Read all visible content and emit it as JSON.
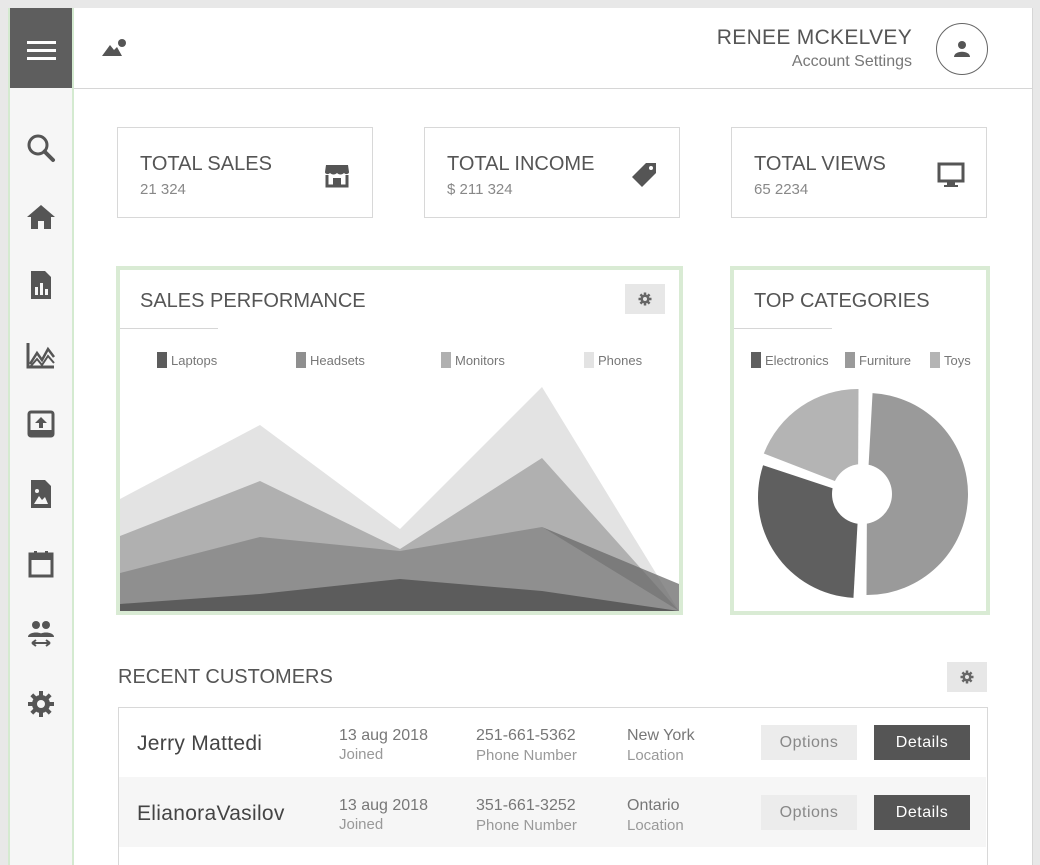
{
  "header": {
    "user_name": "RENEE MCKELVEY",
    "account_link": "Account Settings"
  },
  "sidebar": {
    "items": [
      {
        "icon": "search-icon"
      },
      {
        "icon": "home-icon"
      },
      {
        "icon": "report-icon"
      },
      {
        "icon": "line-chart-icon"
      },
      {
        "icon": "upload-icon"
      },
      {
        "icon": "image-file-icon"
      },
      {
        "icon": "calendar-icon"
      },
      {
        "icon": "transfer-users-icon"
      },
      {
        "icon": "gear-icon"
      }
    ]
  },
  "stats": [
    {
      "title": "TOTAL SALES",
      "value": "21 324",
      "icon": "store-icon"
    },
    {
      "title": "TOTAL INCOME",
      "value": "$ 211 324",
      "icon": "price-tag-icon"
    },
    {
      "title": "TOTAL VIEWS",
      "value": "65 2234",
      "icon": "monitor-icon"
    }
  ],
  "sales_performance": {
    "title": "SALES PERFORMANCE",
    "legend": [
      "Laptops",
      "Headsets",
      "Monitors",
      "Phones"
    ]
  },
  "top_categories": {
    "title": "TOP CATEGORIES",
    "legend": [
      "Electronics",
      "Furniture",
      "Toys"
    ]
  },
  "customers": {
    "title": "RECENT CUSTOMERS",
    "rows": [
      {
        "name": "Jerry Mattedi",
        "date": "13 aug 2018",
        "date_label": "Joined",
        "phone": "251-661-5362",
        "phone_label": "Phone Number",
        "location": "New York",
        "location_label": "Location",
        "options": "Options",
        "details": "Details"
      },
      {
        "name": "ElianoraVasilov",
        "date": "13 aug 2018",
        "date_label": "Joined",
        "phone": "351-661-3252",
        "phone_label": "Phone Number",
        "location": "Ontario",
        "location_label": "Location",
        "options": "Options",
        "details": "Details"
      }
    ]
  },
  "colors": {
    "dark": "#5e5e5e",
    "panel_border": "#d9ebd4",
    "series": [
      "#5c5c5c",
      "#8f8f8f",
      "#b0b0b0",
      "#e3e3e3"
    ],
    "pie": [
      "#5f5f5f",
      "#9a9a9a",
      "#b4b4b4"
    ]
  },
  "chart_data": [
    {
      "type": "area",
      "title": "SALES PERFORMANCE",
      "x": [
        0,
        1,
        2,
        3,
        4
      ],
      "series": [
        {
          "name": "Phones",
          "values": [
            112,
            186,
            82,
            224,
            0
          ]
        },
        {
          "name": "Monitors",
          "values": [
            75,
            130,
            62,
            153,
            0
          ]
        },
        {
          "name": "Headsets",
          "values": [
            38,
            74,
            60,
            84,
            0
          ]
        },
        {
          "name": "Laptops",
          "values": [
            7,
            17,
            32,
            20,
            0
          ]
        }
      ]
    },
    {
      "type": "pie",
      "title": "TOP CATEGORIES",
      "categories": [
        "Electronics",
        "Furniture",
        "Toys"
      ],
      "values": [
        50,
        30,
        20
      ]
    }
  ]
}
